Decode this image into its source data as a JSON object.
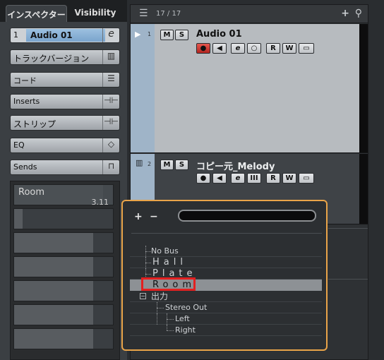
{
  "inspector": {
    "tabs": [
      {
        "label": "インスペクター",
        "active": true
      },
      {
        "label": "Visibility",
        "active": false
      }
    ],
    "track_number": "1",
    "track_name": "Audio 01",
    "track_edit_icon": "e-icon",
    "sections": [
      {
        "label": "トラックバージョン",
        "icon": "versions-icon"
      },
      {
        "label": "コード",
        "icon": "chord-icon"
      },
      {
        "label": "Inserts",
        "icon": "insert-icon"
      },
      {
        "label": "ストリップ",
        "icon": "insert-icon"
      },
      {
        "label": "EQ",
        "icon": "eq-icon"
      },
      {
        "label": "Sends",
        "icon": "sends-icon"
      }
    ],
    "insert_slot": {
      "label": "Room",
      "value": "3.11"
    }
  },
  "tracklist": {
    "count": "17 / 17",
    "tracks": [
      {
        "number": "1",
        "name": "Audio 01",
        "mute": "M",
        "solo": "S",
        "buttons": [
          "●",
          "◀",
          "e",
          "○",
          "R",
          "W",
          "▭"
        ]
      },
      {
        "number": "2",
        "name": "コピー元_Melody",
        "mute": "M",
        "solo": "S",
        "buttons": [
          "●",
          "◀",
          "e",
          "III",
          "R",
          "W",
          "▭"
        ]
      }
    ]
  },
  "popup": {
    "add_label": "+",
    "remove_label": "−",
    "search_value": "",
    "tree": [
      {
        "label": "No Bus",
        "level": 0
      },
      {
        "label": "Hall",
        "level": 0
      },
      {
        "label": "Plate",
        "level": 0
      },
      {
        "label": "Room",
        "level": 0,
        "selected": true
      },
      {
        "label": "出力",
        "level": 0,
        "expanded": true
      },
      {
        "label": "Stereo Out",
        "level": 1
      },
      {
        "label": "Left",
        "level": 2
      },
      {
        "label": "Right",
        "level": 2
      }
    ]
  },
  "colors": {
    "highlight": "#e32020",
    "popup_border": "#e9a449",
    "record": "#d9372f"
  }
}
